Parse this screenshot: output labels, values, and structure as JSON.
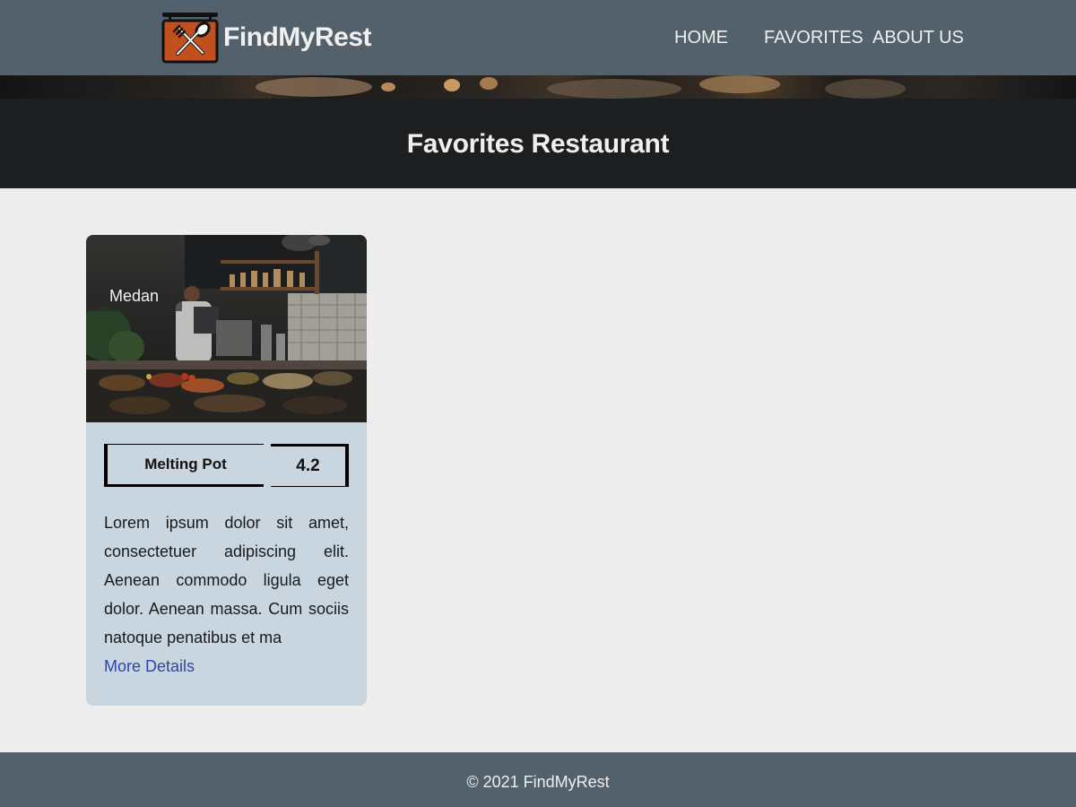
{
  "colors": {
    "navbar": "#52616b",
    "hero": "#1d1e20",
    "page_background": "#ededed",
    "card_background": "#c9d6df",
    "link": "#2f46a8",
    "logo_orange": "#c0501e"
  },
  "header": {
    "brand_name": "FindMyRest",
    "logo_icon": "fork-spoon-sign-icon",
    "nav": {
      "home": "HOME",
      "favorites": "FAVORITES",
      "about": "ABOUT US"
    }
  },
  "hero": {
    "title": "Favorites Restaurant"
  },
  "restaurants": [
    {
      "city": "Medan",
      "name": "Melting Pot",
      "rating": "4.2",
      "description": "Lorem ipsum dolor sit amet, consectetuer adipiscing elit. Aenean commodo ligula eget dolor. Aenean massa. Cum sociis natoque penatibus et ma",
      "link_label": "More Details"
    }
  ],
  "footer": {
    "copyright": "© 2021 FindMyRest"
  }
}
